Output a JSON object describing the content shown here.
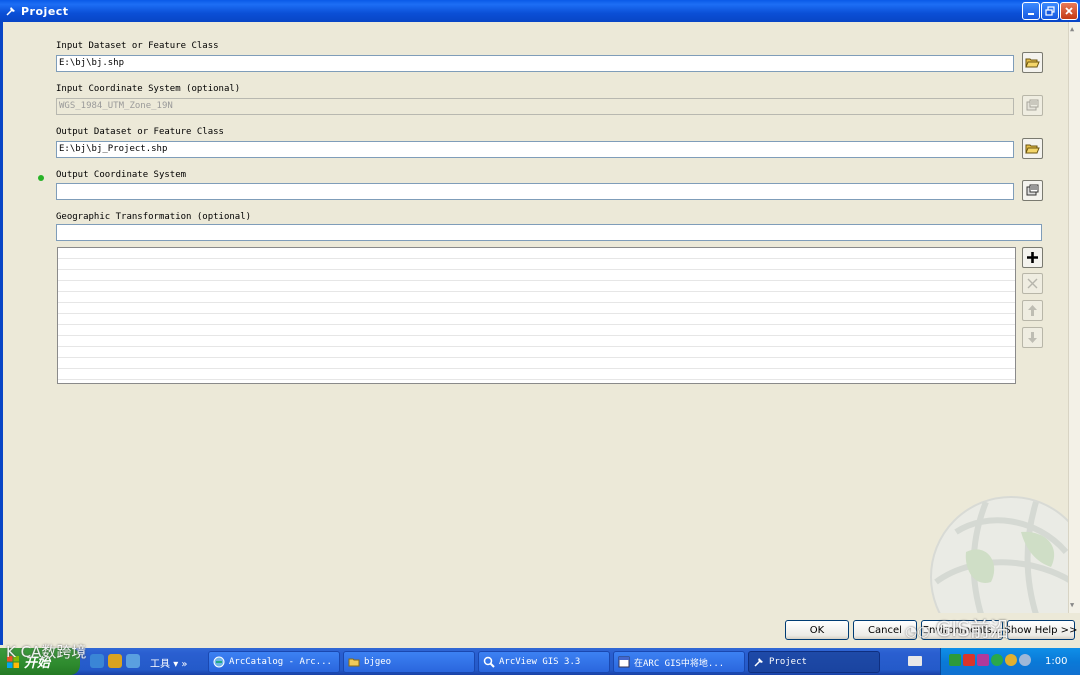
{
  "window": {
    "title": "Project"
  },
  "form": {
    "input_dataset_label": "Input Dataset or Feature Class",
    "input_dataset_value": "E:\\bj\\bj.shp",
    "input_cs_label": "Input Coordinate System (optional)",
    "input_cs_value": "WGS_1984_UTM_Zone_19N",
    "output_dataset_label": "Output Dataset or Feature Class",
    "output_dataset_value": "E:\\bj\\bj_Project.shp",
    "output_cs_label": "Output Coordinate System",
    "output_cs_value": "",
    "geo_transform_label": "Geographic Transformation (optional)",
    "geo_transform_value": ""
  },
  "buttons": {
    "ok": "OK",
    "cancel": "Cancel",
    "environments": "Environments...",
    "show_help": "Show Help >>"
  },
  "taskbar": {
    "start": "开始",
    "tools_menu": "工具",
    "overflow": "»",
    "tasks": [
      {
        "label": "ArcCatalog - Arc..."
      },
      {
        "label": "bjgeo"
      },
      {
        "label": "ArcView GIS 3.3"
      },
      {
        "label": "在ARC GIS中将地..."
      },
      {
        "label": "Project"
      }
    ],
    "clock": "1:00"
  },
  "watermarks": {
    "left": "K CA数跨境",
    "right": "GIS前沿"
  },
  "colors": {
    "titlebar": "#0a5ae8",
    "dialog_bg": "#ece9d8",
    "required_dot": "#27b327",
    "taskbar": "#245ac9",
    "start_button": "#2e8b2e"
  }
}
